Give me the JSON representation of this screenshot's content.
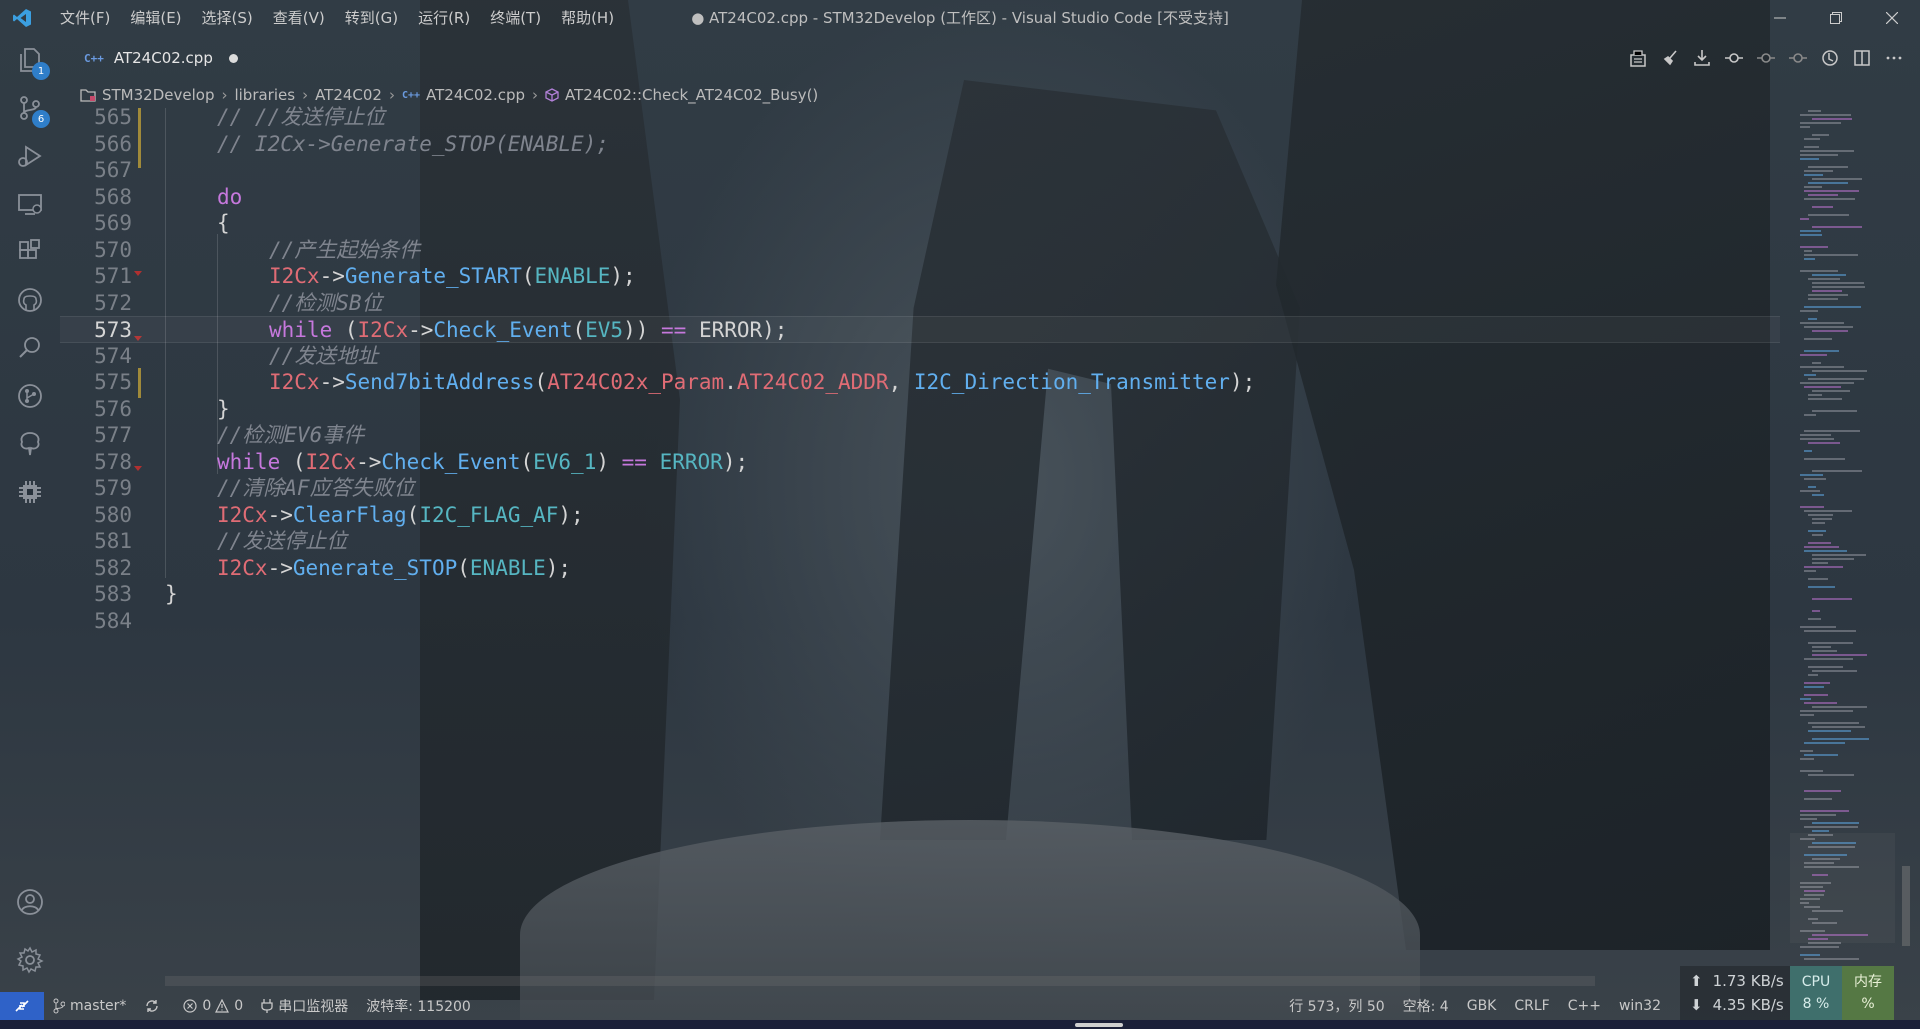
{
  "window": {
    "title": "● AT24C02.cpp - STM32Develop (工作区) - Visual Studio Code [不受支持]"
  },
  "menu": [
    "文件(F)",
    "编辑(E)",
    "选择(S)",
    "查看(V)",
    "转到(G)",
    "运行(R)",
    "终端(T)",
    "帮助(H)"
  ],
  "activity": {
    "explorer_badge": "1",
    "scm_badge": "6"
  },
  "tab": {
    "lang": "C++",
    "filename": "AT24C02.cpp"
  },
  "breadcrumb": {
    "root": "STM32Develop",
    "folder1": "libraries",
    "folder2": "AT24C02",
    "lang": "C++",
    "file": "AT24C02.cpp",
    "symbol": "AT24C02::Check_AT24C02_Busy()"
  },
  "editor": {
    "current_line": 573,
    "lines": [
      {
        "num": "565",
        "indent": 1,
        "tokens": [
          {
            "t": "cm",
            "v": "// //发送停止位"
          }
        ]
      },
      {
        "num": "566",
        "indent": 1,
        "tokens": [
          {
            "t": "cm",
            "v": "// I2Cx->Generate_STOP(ENABLE);"
          }
        ]
      },
      {
        "num": "567",
        "indent": 0,
        "tokens": []
      },
      {
        "num": "568",
        "indent": 1,
        "tokens": [
          {
            "t": "kw",
            "v": "do"
          }
        ]
      },
      {
        "num": "569",
        "indent": 1,
        "tokens": [
          {
            "t": "pl",
            "v": "{"
          }
        ]
      },
      {
        "num": "570",
        "indent": 2,
        "tokens": [
          {
            "t": "cm",
            "v": "//产生起始条件"
          }
        ]
      },
      {
        "num": "571",
        "indent": 2,
        "tokens": [
          {
            "t": "var",
            "v": "I2Cx"
          },
          {
            "t": "pl",
            "v": "->"
          },
          {
            "t": "fn",
            "v": "Generate_START"
          },
          {
            "t": "pl",
            "v": "("
          },
          {
            "t": "cst",
            "v": "ENABLE"
          },
          {
            "t": "pl",
            "v": ");"
          }
        ]
      },
      {
        "num": "572",
        "indent": 2,
        "tokens": [
          {
            "t": "cm",
            "v": "//检测SB位"
          }
        ]
      },
      {
        "num": "573",
        "indent": 2,
        "tokens": [
          {
            "t": "kw",
            "v": "while"
          },
          {
            "t": "pl",
            "v": " ("
          },
          {
            "t": "var",
            "v": "I2Cx"
          },
          {
            "t": "pl",
            "v": "->"
          },
          {
            "t": "fn",
            "v": "Check_Event"
          },
          {
            "t": "pl",
            "v": "("
          },
          {
            "t": "cst",
            "v": "EV5"
          },
          {
            "t": "pl",
            "v": ")) "
          },
          {
            "t": "kw",
            "v": "=="
          },
          {
            "t": "pl",
            "v": " ERROR);"
          }
        ]
      },
      {
        "num": "574",
        "indent": 2,
        "tokens": [
          {
            "t": "cm",
            "v": "//发送地址"
          }
        ]
      },
      {
        "num": "575",
        "indent": 2,
        "tokens": [
          {
            "t": "var",
            "v": "I2Cx"
          },
          {
            "t": "pl",
            "v": "->"
          },
          {
            "t": "fn",
            "v": "Send7bitAddress"
          },
          {
            "t": "pl",
            "v": "("
          },
          {
            "t": "var",
            "v": "AT24C02x_Param"
          },
          {
            "t": "pl",
            "v": "."
          },
          {
            "t": "var",
            "v": "AT24C02_ADDR"
          },
          {
            "t": "pl",
            "v": ", "
          },
          {
            "t": "fn",
            "v": "I2C_Direction_Transmitter"
          },
          {
            "t": "pl",
            "v": ");"
          }
        ]
      },
      {
        "num": "576",
        "indent": 1,
        "tokens": [
          {
            "t": "pl",
            "v": "}"
          }
        ]
      },
      {
        "num": "577",
        "indent": 1,
        "tokens": [
          {
            "t": "cm",
            "v": "//检测EV6事件"
          }
        ]
      },
      {
        "num": "578",
        "indent": 1,
        "tokens": [
          {
            "t": "kw",
            "v": "while"
          },
          {
            "t": "pl",
            "v": " ("
          },
          {
            "t": "var",
            "v": "I2Cx"
          },
          {
            "t": "pl",
            "v": "->"
          },
          {
            "t": "fn",
            "v": "Check_Event"
          },
          {
            "t": "pl",
            "v": "("
          },
          {
            "t": "cst",
            "v": "EV6_1"
          },
          {
            "t": "pl",
            "v": ") "
          },
          {
            "t": "kw",
            "v": "=="
          },
          {
            "t": "pl",
            "v": " "
          },
          {
            "t": "cst",
            "v": "ERROR"
          },
          {
            "t": "pl",
            "v": ");"
          }
        ]
      },
      {
        "num": "579",
        "indent": 1,
        "tokens": [
          {
            "t": "cm",
            "v": "//清除AF应答失败位"
          }
        ]
      },
      {
        "num": "580",
        "indent": 1,
        "tokens": [
          {
            "t": "var",
            "v": "I2Cx"
          },
          {
            "t": "pl",
            "v": "->"
          },
          {
            "t": "fn",
            "v": "ClearFlag"
          },
          {
            "t": "pl",
            "v": "("
          },
          {
            "t": "cst",
            "v": "I2C_FLAG_AF"
          },
          {
            "t": "pl",
            "v": ");"
          }
        ]
      },
      {
        "num": "581",
        "indent": 1,
        "tokens": [
          {
            "t": "cm",
            "v": "//发送停止位"
          }
        ]
      },
      {
        "num": "582",
        "indent": 1,
        "tokens": [
          {
            "t": "var",
            "v": "I2Cx"
          },
          {
            "t": "pl",
            "v": "->"
          },
          {
            "t": "fn",
            "v": "Generate_STOP"
          },
          {
            "t": "pl",
            "v": "("
          },
          {
            "t": "cst",
            "v": "ENABLE"
          },
          {
            "t": "pl",
            "v": ");"
          }
        ]
      },
      {
        "num": "583",
        "indent": 0,
        "tokens": [
          {
            "t": "pl",
            "v": "}"
          }
        ]
      },
      {
        "num": "584",
        "indent": 0,
        "tokens": []
      }
    ]
  },
  "status": {
    "branch": "master*",
    "errors": "0",
    "warnings": "0",
    "serial_monitor": "串口监视器",
    "baud": "波特率: 115200",
    "position": "行 573，列 50",
    "spaces": "空格: 4",
    "encoding": "GBK",
    "eol": "CRLF",
    "language": "C++",
    "platform": "win32"
  },
  "network": {
    "upload": "1.73 KB/s",
    "download": "4.35 KB/s",
    "cpu_label": "CPU",
    "cpu_value": "8 %",
    "mem_label": "内存",
    "mem_value": "%"
  },
  "colors": {
    "keyword": "#c678dd",
    "variable": "#e06c75",
    "function": "#61afef",
    "comment": "#7f848e",
    "constant": "#56b6c2",
    "remote_indicator": "#2f62c8"
  }
}
